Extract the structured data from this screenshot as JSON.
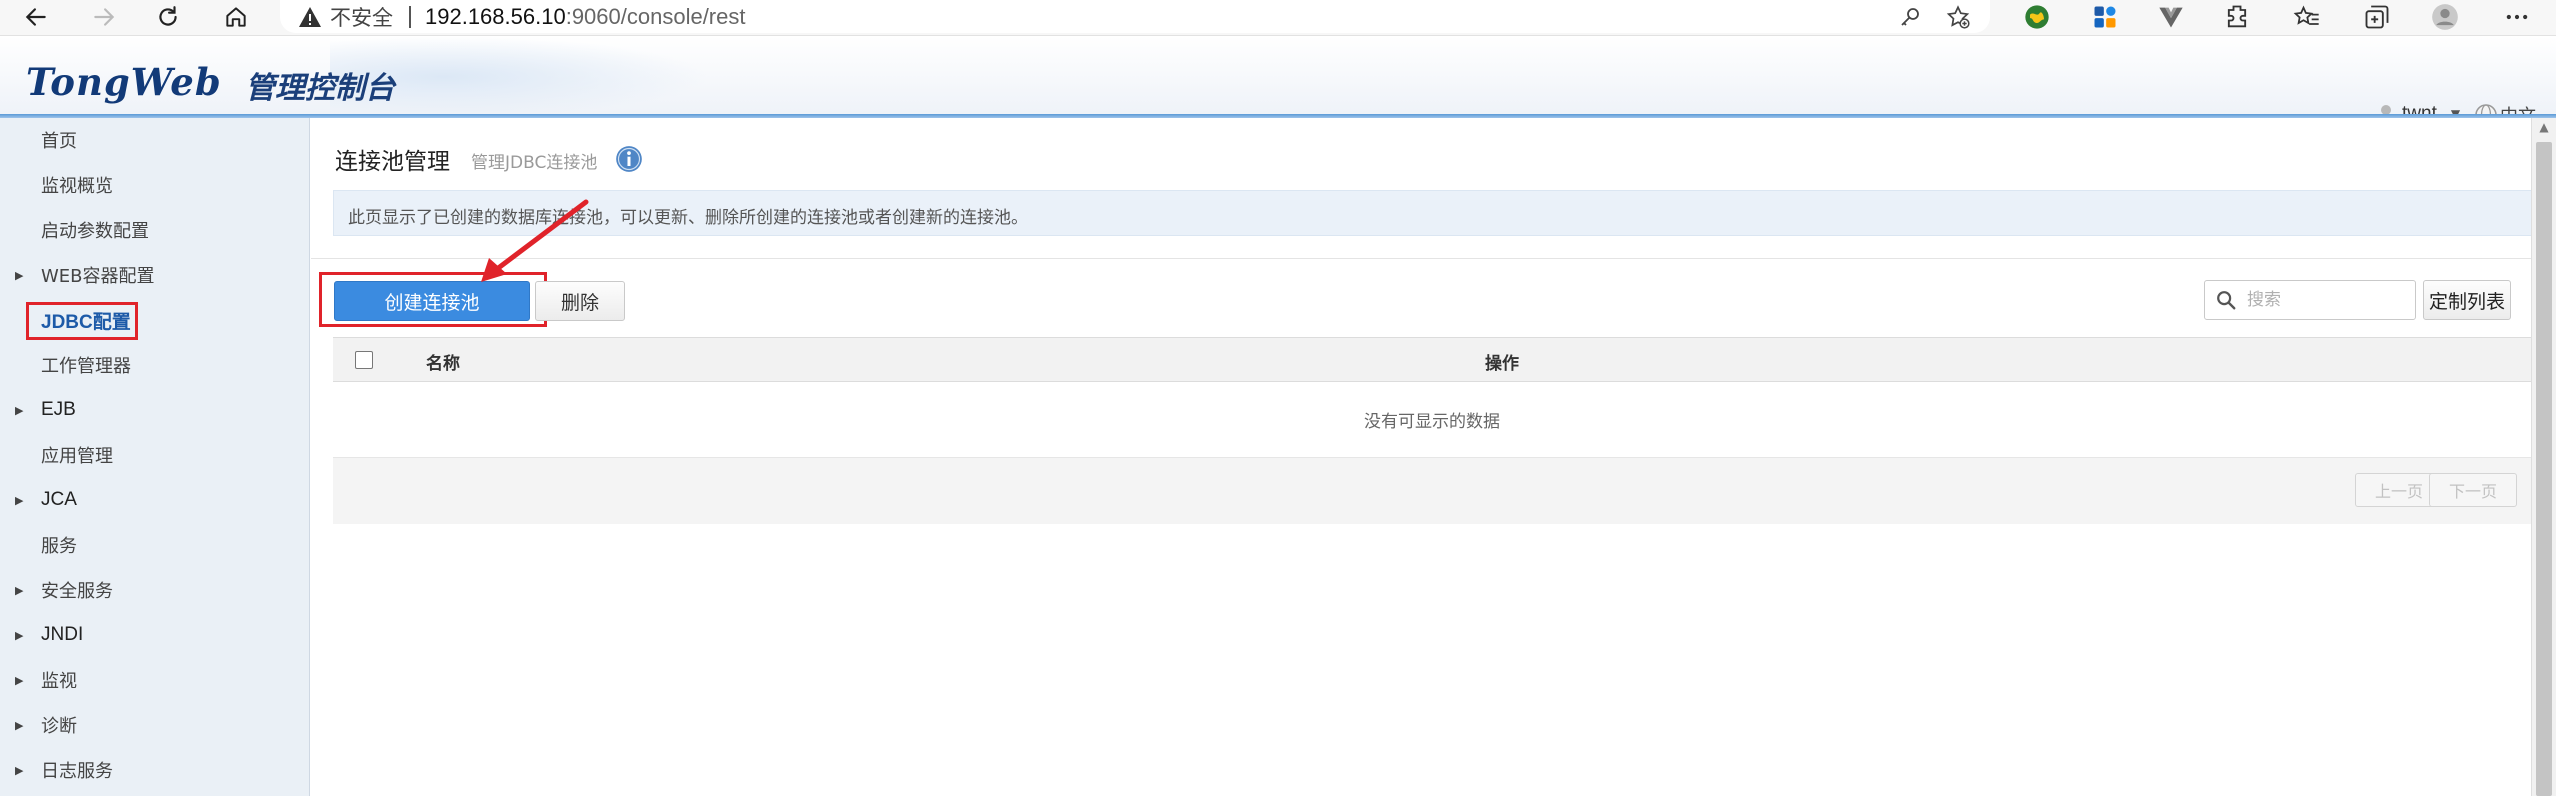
{
  "browser": {
    "insecure_label": "不安全",
    "url_host": "192.168.56.10",
    "url_rest": ":9060/console/rest",
    "icons": [
      "back-icon",
      "forward-icon",
      "refresh-icon",
      "home-icon",
      "warning-icon",
      "key-icon",
      "favorite-add-icon",
      "extension-icons",
      "favorites-icon",
      "collections-icon",
      "profile-icon",
      "more-icon"
    ]
  },
  "header": {
    "logo_main": "TongWeb",
    "logo_sub": "管理控制台",
    "user_name": "twnt",
    "user_caret": "▼",
    "lang_label": "中文"
  },
  "sidebar": {
    "items": [
      {
        "label": "首页",
        "expandable": false
      },
      {
        "label": "监视概览",
        "expandable": false
      },
      {
        "label": "启动参数配置",
        "expandable": false
      },
      {
        "label": "WEB容器配置",
        "expandable": true
      },
      {
        "label": "JDBC配置",
        "expandable": false,
        "active": true
      },
      {
        "label": "工作管理器",
        "expandable": false
      },
      {
        "label": "EJB",
        "expandable": true
      },
      {
        "label": "应用管理",
        "expandable": false
      },
      {
        "label": "JCA",
        "expandable": true
      },
      {
        "label": "服务",
        "expandable": false
      },
      {
        "label": "安全服务",
        "expandable": true
      },
      {
        "label": "JNDI",
        "expandable": true
      },
      {
        "label": "监视",
        "expandable": true
      },
      {
        "label": "诊断",
        "expandable": true
      },
      {
        "label": "日志服务",
        "expandable": true
      }
    ],
    "expand_glyph": "▶"
  },
  "main": {
    "title": "连接池管理",
    "subtitle": "管理JDBC连接池",
    "description": "此页显示了已创建的数据库连接池，可以更新、删除所创建的连接池或者创建新的连接池。",
    "create_label": "创建连接池",
    "delete_label": "删除",
    "search_placeholder": "搜索",
    "customize_label": "定制列表",
    "table": {
      "columns": [
        "名称",
        "操作"
      ],
      "empty_text": "没有可显示的数据"
    },
    "pager": {
      "prev_label": "上一页",
      "next_label": "下一页"
    }
  },
  "colors": {
    "primary_button": "#3b8be0",
    "highlight": "#e0232a",
    "sidebar_bg": "#eaf0f6",
    "active_link": "#1d5aa8"
  }
}
